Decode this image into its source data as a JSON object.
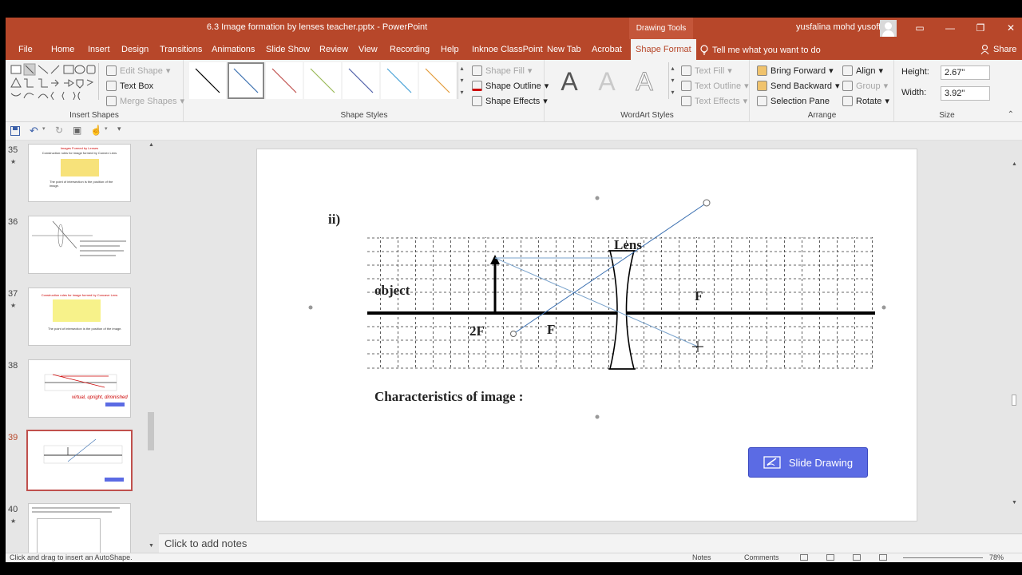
{
  "window": {
    "title": "6.3 Image formation by lenses teacher.pptx  -  PowerPoint",
    "context_tab": "Drawing Tools",
    "user": "yusfalina mohd yusoff"
  },
  "tabs": [
    "File",
    "Home",
    "Insert",
    "Design",
    "Transitions",
    "Animations",
    "Slide Show",
    "Review",
    "View",
    "Recording",
    "Help",
    "Inknoe ClassPoint",
    "New Tab",
    "Acrobat",
    "Shape Format"
  ],
  "tell_me": "Tell me what you want to do",
  "share": "Share",
  "ribbon": {
    "insert_shapes": {
      "label": "Insert Shapes",
      "edit_shape": "Edit Shape",
      "text_box": "Text Box",
      "merge_shapes": "Merge Shapes"
    },
    "shape_styles": {
      "label": "Shape Styles",
      "shape_fill": "Shape Fill",
      "shape_outline": "Shape Outline",
      "shape_effects": "Shape Effects"
    },
    "wordart": {
      "label": "WordArt Styles",
      "text_fill": "Text Fill",
      "text_outline": "Text Outline",
      "text_effects": "Text Effects",
      "sample": "A"
    },
    "arrange": {
      "label": "Arrange",
      "bring_forward": "Bring Forward",
      "send_backward": "Send Backward",
      "selection_pane": "Selection Pane",
      "align": "Align",
      "group": "Group",
      "rotate": "Rotate"
    },
    "size": {
      "label": "Size",
      "height_label": "Height:",
      "height": "2.67\"",
      "width_label": "Width:",
      "width": "3.92\""
    }
  },
  "style_colors": [
    "#000000",
    "#3a6fb0",
    "#c0504d",
    "#9bbb59",
    "#4f5fa8",
    "#4aa3d8",
    "#e39a3a"
  ],
  "thumbnails": [
    {
      "num": "35",
      "star": true,
      "title": "Images Formed by Lenses",
      "subtitle": "Construction rules for image formed by Convex Lens",
      "text": "The point of intersection is the position of the image."
    },
    {
      "num": "36",
      "star": false,
      "title": "",
      "subtitle": "",
      "text": ""
    },
    {
      "num": "37",
      "star": true,
      "title": "Construction rules for image formed by Concave Lens",
      "subtitle": "",
      "text": "The point of intersection is the position of the image."
    },
    {
      "num": "38",
      "star": false,
      "title": "",
      "subtitle": "",
      "text": "virtual, upright, diminished"
    },
    {
      "num": "39",
      "star": true,
      "selected": true
    },
    {
      "num": "40",
      "star": true
    }
  ],
  "slide": {
    "label": "ii)",
    "lens_label": "Lens",
    "object_label": "object",
    "f_right": "F",
    "two_f": "2F",
    "f_left": "F",
    "characteristics": "Characteristics of image :",
    "button": "Slide Drawing"
  },
  "notes_placeholder": "Click to add notes",
  "status": {
    "hint": "Click and drag to insert an AutoShape.",
    "notes": "Notes",
    "comments": "Comments",
    "zoom": "78%"
  }
}
